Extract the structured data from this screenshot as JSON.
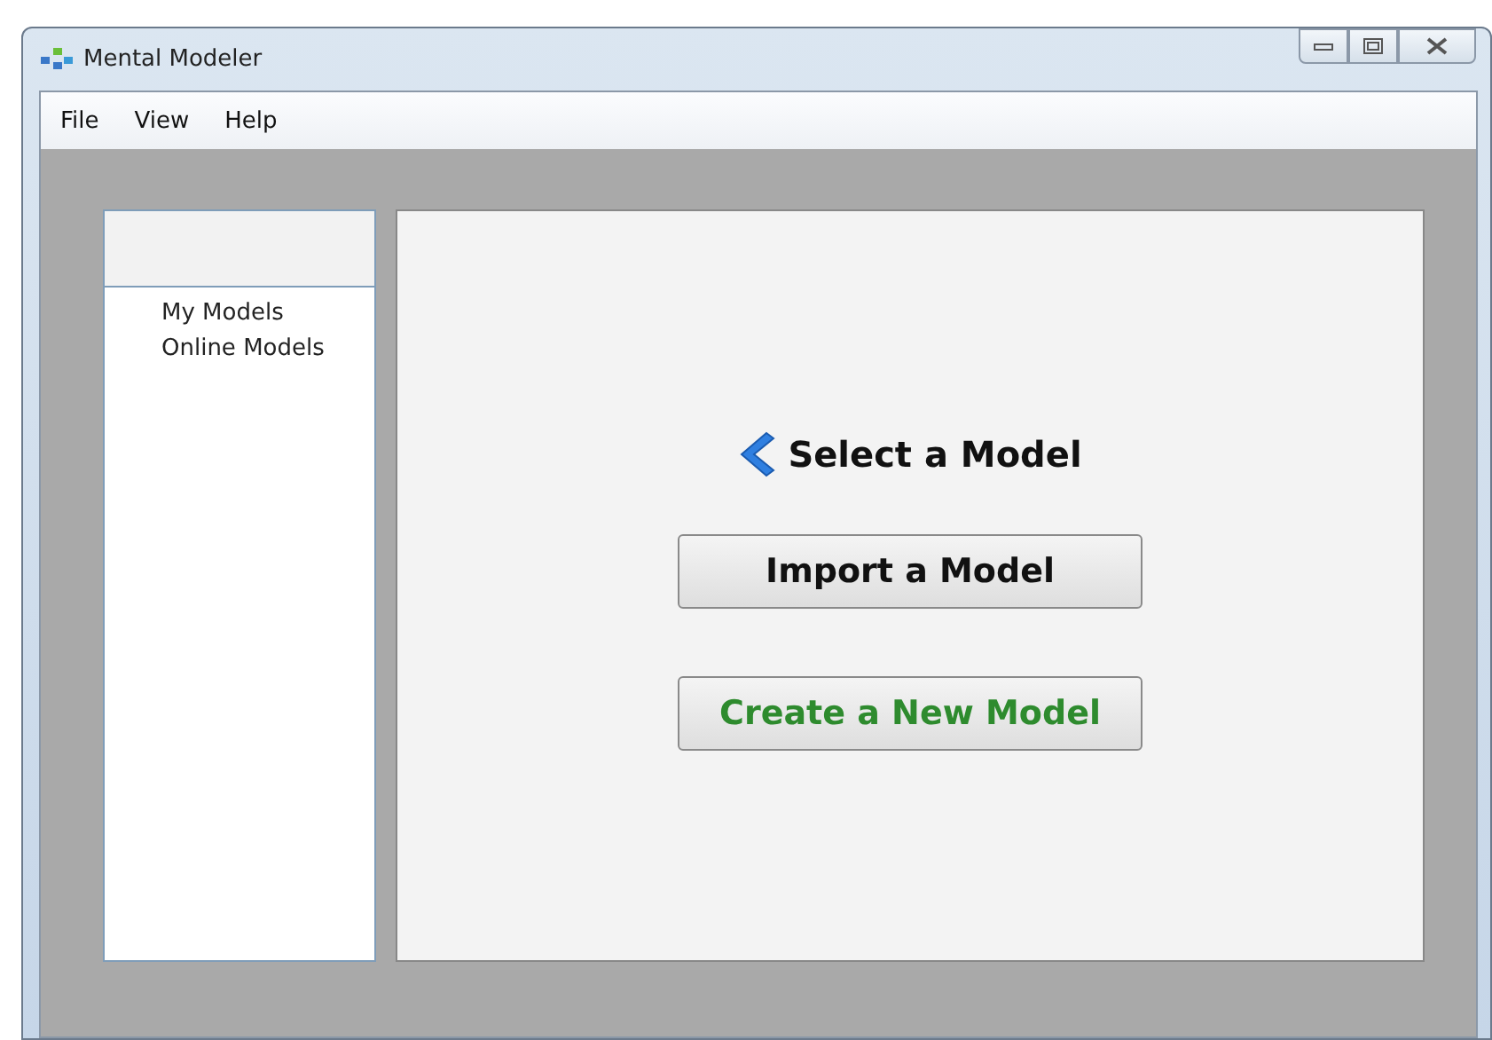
{
  "window": {
    "title": "Mental Modeler"
  },
  "menu": [
    "File",
    "View",
    "Help"
  ],
  "sidebar": {
    "items": [
      {
        "label": "My Models"
      },
      {
        "label": "Online Models"
      }
    ]
  },
  "main": {
    "heading": "Select a Model",
    "buttons": [
      {
        "label": "Import a Model",
        "color": "#111111"
      },
      {
        "label": "Create a New Model",
        "color": "#2e8b2e"
      }
    ]
  }
}
